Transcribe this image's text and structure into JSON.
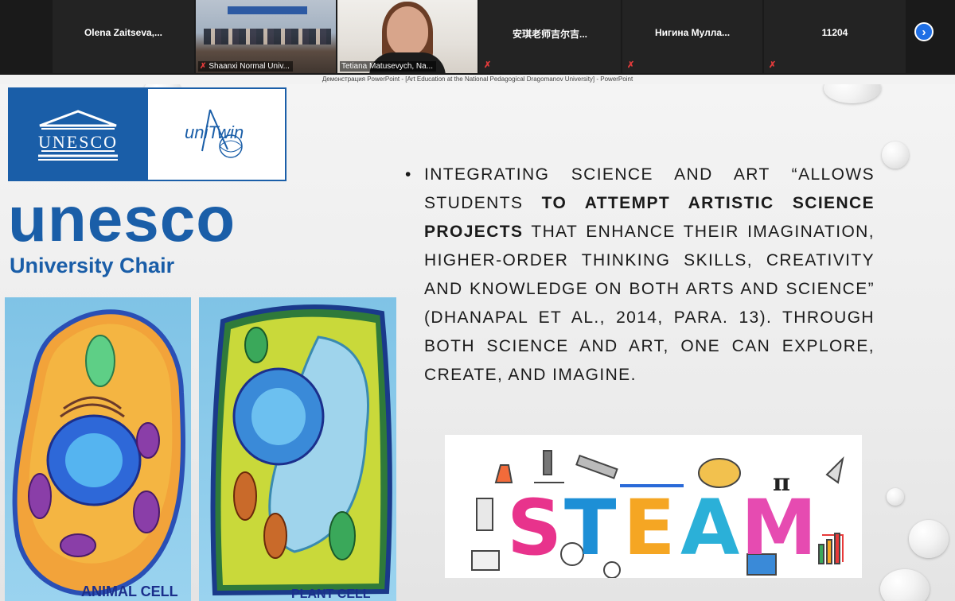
{
  "zoom": {
    "participants": [
      {
        "name": "Olena  Zaitseva,...",
        "kind": "name-only"
      },
      {
        "name": "Shaanxi Normal Univ...",
        "kind": "video-room"
      },
      {
        "name": "Tetiana Matusevych, Na...",
        "kind": "video-face"
      },
      {
        "name": "安琪老师吉尔吉...",
        "kind": "name-only"
      },
      {
        "name": "Нигина  Мулла...",
        "kind": "name-only"
      },
      {
        "name": "11204",
        "kind": "name-only"
      }
    ],
    "next_icon": "chevron-right-icon"
  },
  "window_title": "Демонстрация PowerPoint - [Art Education at the National Pedagogical Dragomanov University] - PowerPoint",
  "slide": {
    "logo_unesco": "UNESCO",
    "logo_unitwin": "uniTwin",
    "unesco_big": "unesco",
    "chair": "University Chair",
    "left_caption": "ANIMAL CELL",
    "right_caption": "PLANT CELL",
    "text_p1": "Integrating science and art “allows students ",
    "text_bold": "to attempt artistic science projects",
    "text_p2": " that enhance their imagination, higher-order thinking skills, creativity and knowledge on both arts and science” (Dhanapal et al., 2014, para. 13). Through both science and art, one can explore, create, and imagine.",
    "steam_word": "STEAM"
  },
  "colors": {
    "unesco_blue": "#1a5ea8",
    "zoom_blue": "#1f6fe5",
    "mic_red": "#e23b3b",
    "steam_s": "#e8338c",
    "steam_t": "#1d8fd6",
    "steam_e": "#f5a623",
    "steam_a": "#2bb0d8",
    "steam_m": "#e64bb1"
  }
}
